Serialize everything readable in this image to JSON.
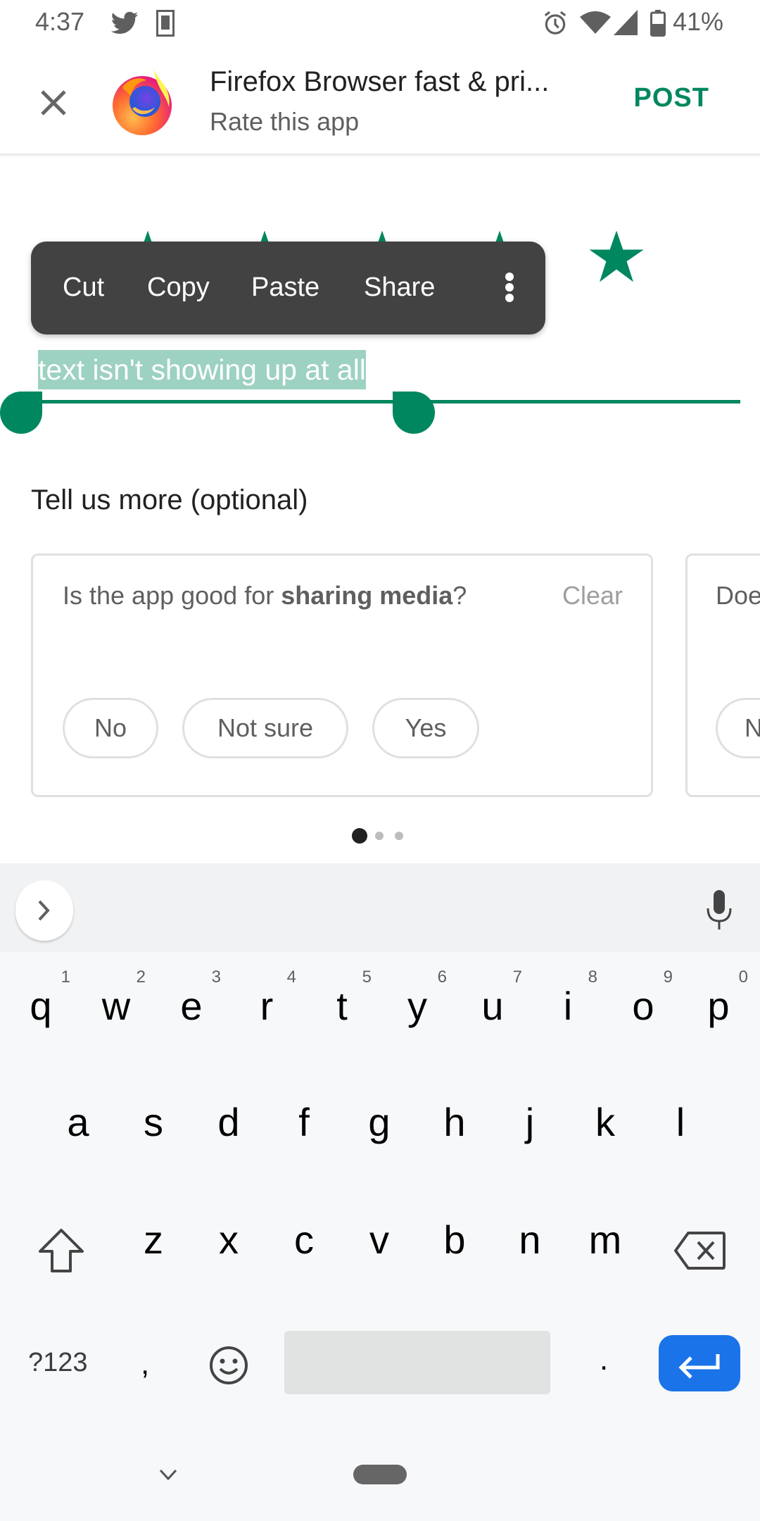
{
  "status_bar": {
    "time": "4:37",
    "notification_icons": [
      "twitter-icon",
      "kindle-icon"
    ],
    "system_icons": [
      "alarm-icon",
      "wifi-icon",
      "cell-signal-icon",
      "battery-icon"
    ],
    "battery_percent": "41%"
  },
  "header": {
    "close_icon": "close-icon",
    "app_title": "Firefox Browser fast & pri...",
    "subtitle": "Rate this app",
    "post_label": "POST",
    "accent_color": "#01875f"
  },
  "rating": {
    "max": 5,
    "value": 5
  },
  "context_menu": {
    "items": [
      "Cut",
      "Copy",
      "Paste",
      "Share"
    ],
    "more_icon": "more-vert-icon"
  },
  "review_input": {
    "value": "text isn't showing up at all",
    "selection": "text isn't showing up at all"
  },
  "tell_more": {
    "title": "Tell us more (optional)",
    "cards": [
      {
        "question_prefix": "Is the app good for ",
        "question_bold": "sharing media",
        "question_suffix": "?",
        "clear_label": "Clear",
        "options": [
          "No",
          "Not sure",
          "Yes"
        ]
      },
      {
        "question_prefix": "Doe",
        "options": [
          "N"
        ]
      }
    ],
    "page_indicator": {
      "count": 3,
      "active": 1
    }
  },
  "keyboard": {
    "row1": [
      {
        "key": "q",
        "hint": "1"
      },
      {
        "key": "w",
        "hint": "2"
      },
      {
        "key": "e",
        "hint": "3"
      },
      {
        "key": "r",
        "hint": "4"
      },
      {
        "key": "t",
        "hint": "5"
      },
      {
        "key": "y",
        "hint": "6"
      },
      {
        "key": "u",
        "hint": "7"
      },
      {
        "key": "i",
        "hint": "8"
      },
      {
        "key": "o",
        "hint": "9"
      },
      {
        "key": "p",
        "hint": "0"
      }
    ],
    "row2": [
      "a",
      "s",
      "d",
      "f",
      "g",
      "h",
      "j",
      "k",
      "l"
    ],
    "row3": [
      "z",
      "x",
      "c",
      "v",
      "b",
      "n",
      "m"
    ],
    "symbols_label": "?123",
    "comma": ",",
    "period": ".",
    "enter_color": "#1a73e8"
  }
}
